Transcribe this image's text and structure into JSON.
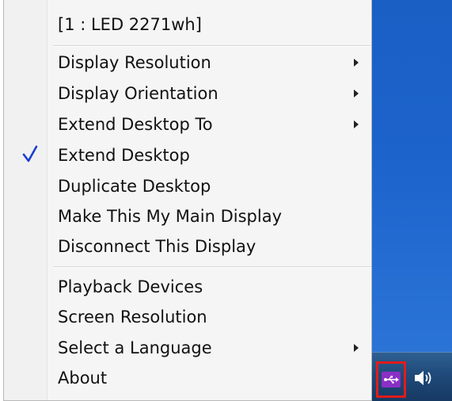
{
  "menu": {
    "header": "[1 : LED 2271wh]",
    "items": [
      {
        "label": "Display Resolution",
        "submenu": true,
        "checked": false
      },
      {
        "label": "Display Orientation",
        "submenu": true,
        "checked": false
      },
      {
        "label": "Extend Desktop To",
        "submenu": true,
        "checked": false
      },
      {
        "label": "Extend Desktop",
        "submenu": false,
        "checked": true
      },
      {
        "label": "Duplicate Desktop",
        "submenu": false,
        "checked": false
      },
      {
        "label": "Make This My Main Display",
        "submenu": false,
        "checked": false
      },
      {
        "label": "Disconnect This Display",
        "submenu": false,
        "checked": false
      },
      {
        "label": "Playback Devices",
        "submenu": false,
        "checked": false
      },
      {
        "label": "Screen Resolution",
        "submenu": false,
        "checked": false
      },
      {
        "label": "Select a Language",
        "submenu": true,
        "checked": false
      },
      {
        "label": "About",
        "submenu": false,
        "checked": false
      }
    ]
  },
  "tray": {
    "usb_icon": "usb-display-icon",
    "speaker_icon": "speaker-icon",
    "highlight_color": "#e21b1b"
  },
  "colors": {
    "check": "#1a3fd0",
    "desktop": "#1c63cc"
  }
}
